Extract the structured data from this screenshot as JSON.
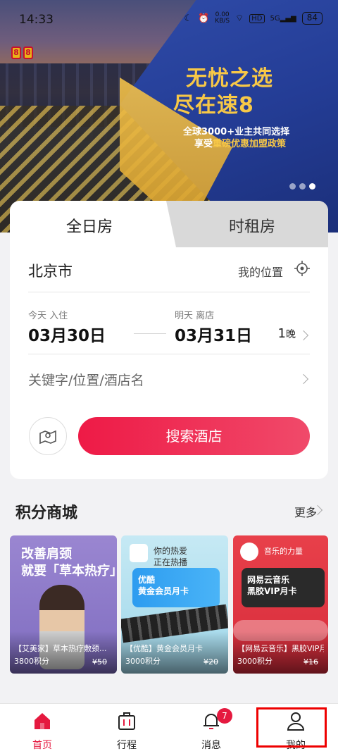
{
  "status_bar": {
    "time": "14:33",
    "net_speed": "0.00",
    "net_unit": "KB/S",
    "signal": "5G",
    "battery": "84",
    "hd": "HD"
  },
  "banner": {
    "logo_chars": [
      "8",
      "8"
    ],
    "slogan_line1": "无忧之选",
    "slogan_line2": "尽在速8",
    "sub_line1_pre": "全球",
    "sub_line1_hl": "3000+",
    "sub_line1_post": "业主共同选择",
    "sub_line2_pre": "享受",
    "sub_line2_hl": "重磅优惠加盟政策"
  },
  "booking": {
    "tab_allday": "全日房",
    "tab_hourly": "时租房",
    "city": "北京市",
    "my_location": "我的位置",
    "checkin_label": "今天 入住",
    "checkin_date": "03月30日",
    "checkout_label": "明天 离店",
    "checkout_date": "03月31日",
    "nights_num": "1",
    "nights_unit": "晚",
    "keyword_placeholder": "关键字/位置/酒店名",
    "search_button": "搜索酒店"
  },
  "mall": {
    "title": "积分商城",
    "more": "更多",
    "products": [
      {
        "headline1": "改善肩颈",
        "headline2": "就要「草本热疗」",
        "name": "【艾美家】草本热疗敷颈...",
        "points": "3800积分",
        "old_price": "¥50"
      },
      {
        "handwriting1": "你的热爱",
        "handwriting2": "正在热播",
        "card_line1": "优酷",
        "card_line2": "黄金会员月卡",
        "name": "【优酷】黄金会员月卡",
        "points": "3000积分",
        "old_price": "¥20"
      },
      {
        "handwriting1": "音乐的力量",
        "card_line1": "网易云音乐",
        "card_line2": "黑胶VIP月卡",
        "name": "【网易云音乐】黑胶VIP月卡",
        "points": "3000积分",
        "old_price": "¥16"
      }
    ]
  },
  "nav": {
    "items": [
      {
        "label": "首页"
      },
      {
        "label": "行程"
      },
      {
        "label": "消息",
        "badge": "7"
      },
      {
        "label": "我的"
      }
    ]
  },
  "colors": {
    "brand_red": "#e5193f",
    "gold": "#f7c847"
  }
}
